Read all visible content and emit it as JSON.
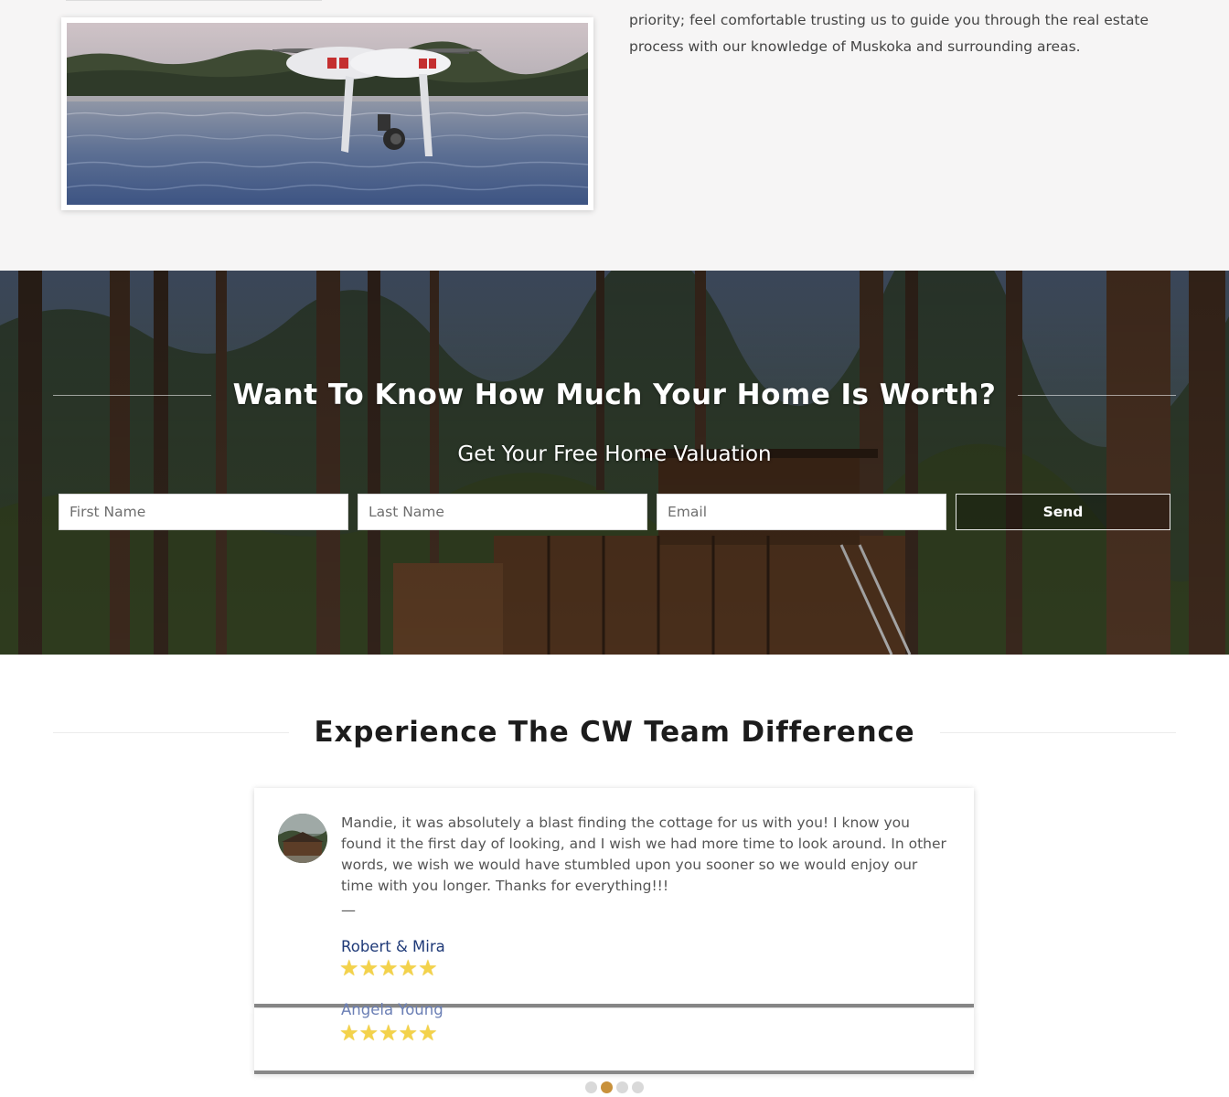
{
  "about": {
    "paragraph": "priority; feel comfortable trusting us to guide you through the real estate process with our knowledge of Muskoka and surrounding areas."
  },
  "valuation": {
    "title": "Want To Know How Much Your Home Is Worth?",
    "subtitle": "Get Your Free Home Valuation",
    "first_name_placeholder": "First Name",
    "last_name_placeholder": "Last Name",
    "email_placeholder": "Email",
    "send_label": "Send"
  },
  "testimonials": {
    "title": "Experience The CW Team Difference",
    "items": [
      {
        "quote": "Mandie, it was absolutely a blast finding the cottage for us with you! I know you found it the first day of looking, and I wish we had more time to look around. In other words, we wish we would have stumbled upon you sooner so we would enjoy our time with you longer. Thanks for everything!!!",
        "dash": "—",
        "name": "Robert & Mira",
        "rating": 5
      },
      {
        "name": "Angela Young",
        "rating": 5
      }
    ],
    "carousel": {
      "slides": 4,
      "active_index": 1
    }
  },
  "colors": {
    "reviewer_name": "#1f3a78",
    "star": "#f3d24b",
    "active_dot": "#c8913b",
    "inactive_dot": "#d9d9d9"
  }
}
